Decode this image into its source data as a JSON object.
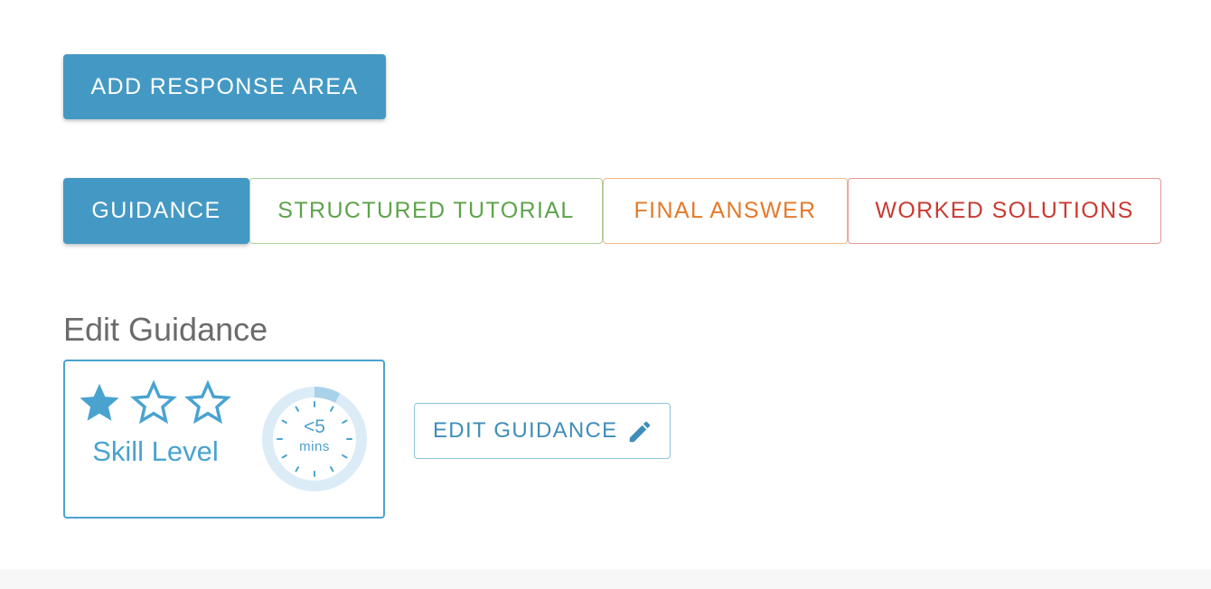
{
  "toolbar": {
    "add_response_area_label": "ADD RESPONSE AREA"
  },
  "tabs": [
    {
      "label": "GUIDANCE",
      "active": true,
      "color": "#4499c4"
    },
    {
      "label": "STRUCTURED TUTORIAL",
      "active": false,
      "color": "#5ea34b"
    },
    {
      "label": "FINAL ANSWER",
      "active": false,
      "color": "#e27a2c"
    },
    {
      "label": "WORKED SOLUTIONS",
      "active": false,
      "color": "#c93a33"
    }
  ],
  "section": {
    "title": "Edit Guidance"
  },
  "guidance": {
    "skill_label": "Skill Level",
    "skill_level": 1,
    "skill_max": 3,
    "time_value": "<5",
    "time_unit": "mins",
    "edit_label": "EDIT GUIDANCE"
  },
  "icons": {
    "star": "star-icon",
    "timer": "timer-icon",
    "edit": "pencil-icon"
  },
  "colors": {
    "accent": "#4499c4",
    "light_accent": "#cfe6f3"
  }
}
